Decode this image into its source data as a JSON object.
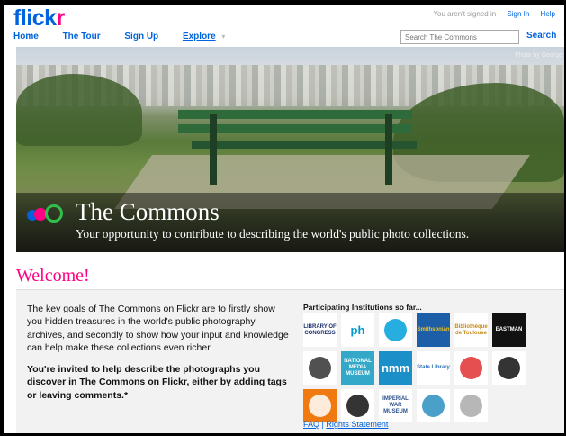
{
  "header": {
    "logo_flick": "flick",
    "logo_r": "r",
    "not_signed_in": "You aren't signed in",
    "sign_in": "Sign In",
    "help": "Help"
  },
  "nav": {
    "home": "Home",
    "tour": "The Tour",
    "signup": "Sign Up",
    "explore": "Explore",
    "explore_caret": "▾"
  },
  "search": {
    "placeholder": "Search The Commons",
    "button": "Search",
    "caret": "▾"
  },
  "hero": {
    "credit": "Photo by George",
    "title": "The Commons",
    "subtitle": "Your opportunity to contribute to describing the world's public photo collections."
  },
  "welcome": {
    "heading": "Welcome!",
    "intro": "The key goals of The Commons on Flickr are to firstly show you hidden treasures in the world's public photography archives, and secondly to show how your input and knowledge can help make these collections even richer.",
    "invite": "You're invited to help describe the photographs you discover in The Commons on Flickr, either by adding tags or leaving comments.*"
  },
  "institutions": {
    "title": "Participating Institutions so far...",
    "logos": [
      {
        "name": "library-of-congress",
        "text": "LIBRARY OF CONGRESS",
        "bg": "#ffffff",
        "fg": "#1a2d6b"
      },
      {
        "name": "powerhouse-museum",
        "text": "ph",
        "bg": "#ffffff",
        "fg": "#0099cc"
      },
      {
        "name": "pinwheel-logo",
        "text": "",
        "bg": "#ffffff",
        "fg": "#00a0dc"
      },
      {
        "name": "smithsonian",
        "text": "Smithsonian",
        "bg": "#1c5fa8",
        "fg": "#f2c21b"
      },
      {
        "name": "bibliotheque-toulouse",
        "text": "Bibliothèque de Toulouse",
        "bg": "#ffffff",
        "fg": "#c48a1c"
      },
      {
        "name": "george-eastman-house",
        "text": "EASTMAN",
        "bg": "#111111",
        "fg": "#ffffff"
      },
      {
        "name": "seal-logo",
        "text": "",
        "bg": "#ffffff",
        "fg": "#333333"
      },
      {
        "name": "national-media-museum",
        "text": "NATIONAL MEDIA MUSEUM",
        "bg": "#33a8c8",
        "fg": "#ffffff"
      },
      {
        "name": "nmm",
        "text": "nmm",
        "bg": "#1a8fc8",
        "fg": "#ffffff"
      },
      {
        "name": "state-library-nsw",
        "text": "State Library",
        "bg": "#ffffff",
        "fg": "#2a6fb8"
      },
      {
        "name": "book-logo",
        "text": "",
        "bg": "#ffffff",
        "fg": "#e03030"
      },
      {
        "name": "building-logo",
        "text": "",
        "bg": "#ffffff",
        "fg": "#111111"
      },
      {
        "name": "orange-logo",
        "text": "",
        "bg": "#f07a10",
        "fg": "#ffffff"
      },
      {
        "name": "black-icon-logo",
        "text": "",
        "bg": "#ffffff",
        "fg": "#111111"
      },
      {
        "name": "imperial-war-museum",
        "text": "IMPERIAL WAR MUSEUM",
        "bg": "#ffffff",
        "fg": "#2a4f8a"
      },
      {
        "name": "star-logo",
        "text": "",
        "bg": "#ffffff",
        "fg": "#2a8fc0"
      },
      {
        "name": "gray-circle-logo",
        "text": "",
        "bg": "#ffffff",
        "fg": "#aaaaaa"
      }
    ]
  },
  "footer": {
    "faq": "FAQ",
    "sep": "|",
    "rights": "Rights Statement"
  }
}
